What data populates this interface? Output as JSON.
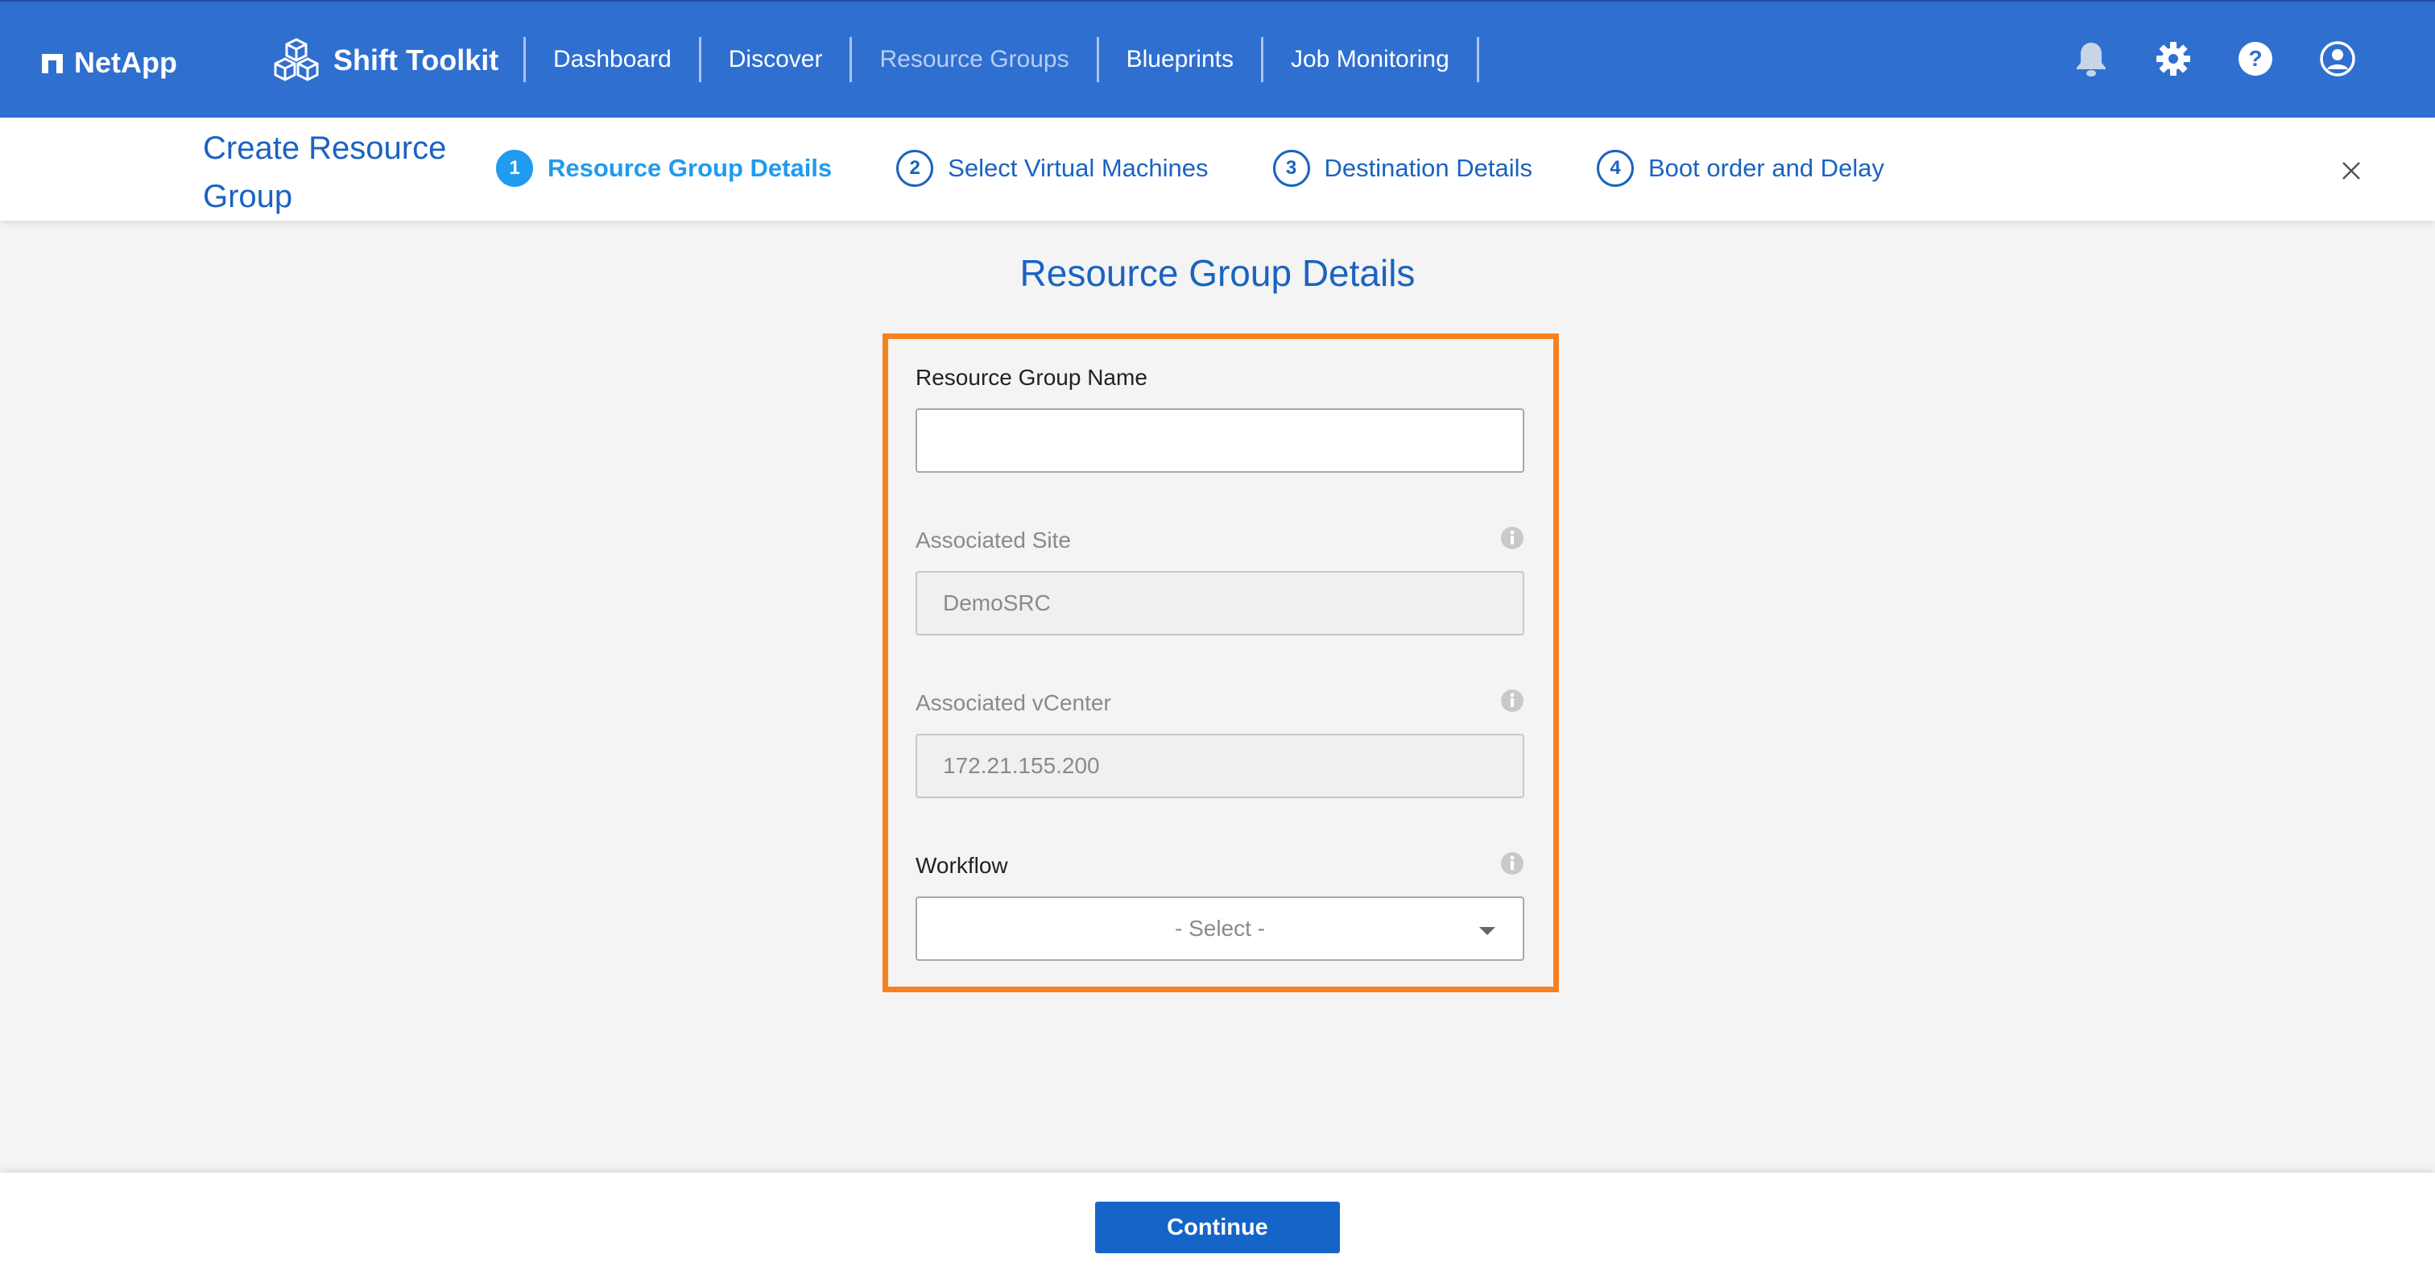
{
  "topbar": {
    "brand": "NetApp",
    "product": "Shift Toolkit",
    "nav": [
      {
        "label": "Dashboard",
        "active": false
      },
      {
        "label": "Discover",
        "active": false
      },
      {
        "label": "Resource Groups",
        "active": true
      },
      {
        "label": "Blueprints",
        "active": false
      },
      {
        "label": "Job Monitoring",
        "active": false
      }
    ],
    "icons": [
      "bell-icon",
      "gear-icon",
      "help-icon",
      "user-icon"
    ]
  },
  "wizard": {
    "title": "Create Resource Group",
    "steps": [
      {
        "number": "1",
        "label": "Resource Group Details",
        "active": true
      },
      {
        "number": "2",
        "label": "Select Virtual Machines",
        "active": false
      },
      {
        "number": "3",
        "label": "Destination Details",
        "active": false
      },
      {
        "number": "4",
        "label": "Boot order and Delay",
        "active": false
      }
    ]
  },
  "form": {
    "title": "Resource Group Details",
    "resource_group_name": {
      "label": "Resource Group Name",
      "value": "",
      "placeholder": ""
    },
    "associated_site": {
      "label": "Associated Site",
      "value": "DemoSRC"
    },
    "associated_vcenter": {
      "label": "Associated vCenter",
      "value": "172.21.155.200"
    },
    "workflow": {
      "label": "Workflow",
      "selected": "- Select -"
    }
  },
  "footer": {
    "continue_label": "Continue"
  },
  "colors": {
    "primary": "#2f6fd0",
    "accent": "#1f9bf0",
    "highlight": "#f58220",
    "button": "#1565c8"
  }
}
